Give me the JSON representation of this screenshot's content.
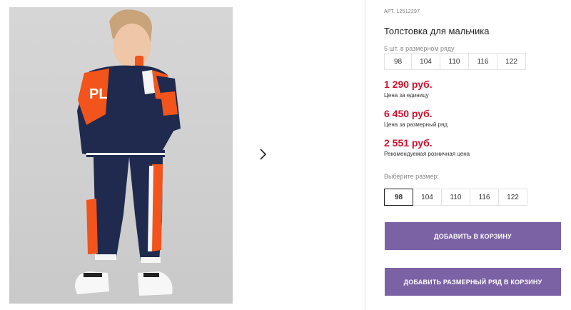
{
  "product": {
    "article_label": "АРТ. 12512297",
    "title": "Толстовка для мальчика",
    "set_info": "5 шт. в размерном ряду",
    "set_sizes": [
      "98",
      "104",
      "110",
      "116",
      "122"
    ],
    "prices": [
      {
        "value": "1 290 руб.",
        "caption": "Цена за единицу"
      },
      {
        "value": "6 450 руб.",
        "caption": "Цена за размерный ряд"
      },
      {
        "value": "2 551 руб.",
        "caption": "Рекомендуемая розничная цена"
      }
    ],
    "choose_size_label": "Выберите размер:",
    "size_options": [
      "98",
      "104",
      "110",
      "116",
      "122"
    ],
    "selected_size": "98",
    "add_to_cart_label": "ДОБАВИТЬ В КОРЗИНУ",
    "add_set_to_cart_label": "ДОБАВИТЬ РАЗМЕРНЫЙ РЯД В КОРЗИНУ"
  },
  "gallery": {
    "next_icon": "chevron-right-icon"
  },
  "colors": {
    "price": "#d1122d",
    "button": "#7b62a5",
    "navy": "#1f2a4e",
    "orange": "#f2541b"
  }
}
